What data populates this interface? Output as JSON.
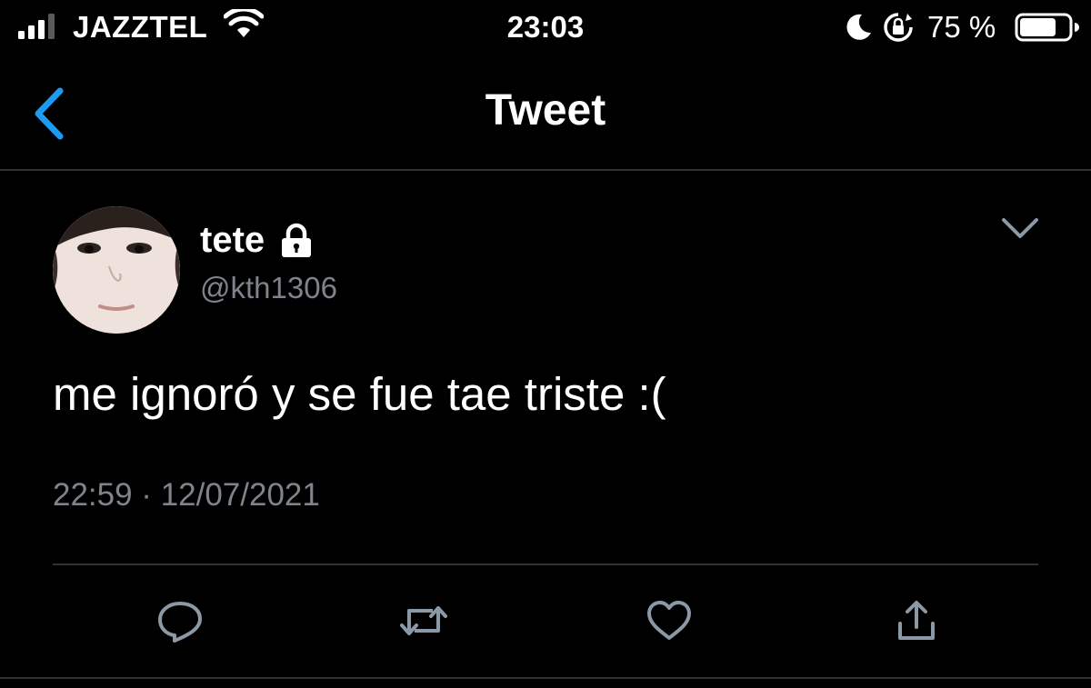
{
  "status_bar": {
    "carrier": "JAZZTEL",
    "time": "23:03",
    "battery_percent": "75 %",
    "battery_level": 0.75,
    "icons": [
      "signal-icon",
      "wifi-icon",
      "moon-icon",
      "rotation-lock-icon",
      "battery-icon"
    ]
  },
  "nav": {
    "title": "Tweet",
    "back_icon": "chevron-left-icon"
  },
  "tweet": {
    "user_name": "tete",
    "handle": "@kth1306",
    "protected_icon": "lock-icon",
    "text": "me ignoró y se fue tae triste :(",
    "timestamp": "22:59 · 12/07/2021",
    "menu_icon": "chevron-down-icon"
  },
  "actions": [
    {
      "name": "reply",
      "icon": "reply-icon"
    },
    {
      "name": "retweet",
      "icon": "retweet-icon"
    },
    {
      "name": "like",
      "icon": "heart-icon"
    },
    {
      "name": "share",
      "icon": "share-icon"
    }
  ],
  "colors": {
    "background": "#000000",
    "text": "#ffffff",
    "secondary_text": "#7e848a",
    "accent": "#1d9bf0",
    "divider": "#2f3336",
    "icon": "#8b98a5"
  }
}
